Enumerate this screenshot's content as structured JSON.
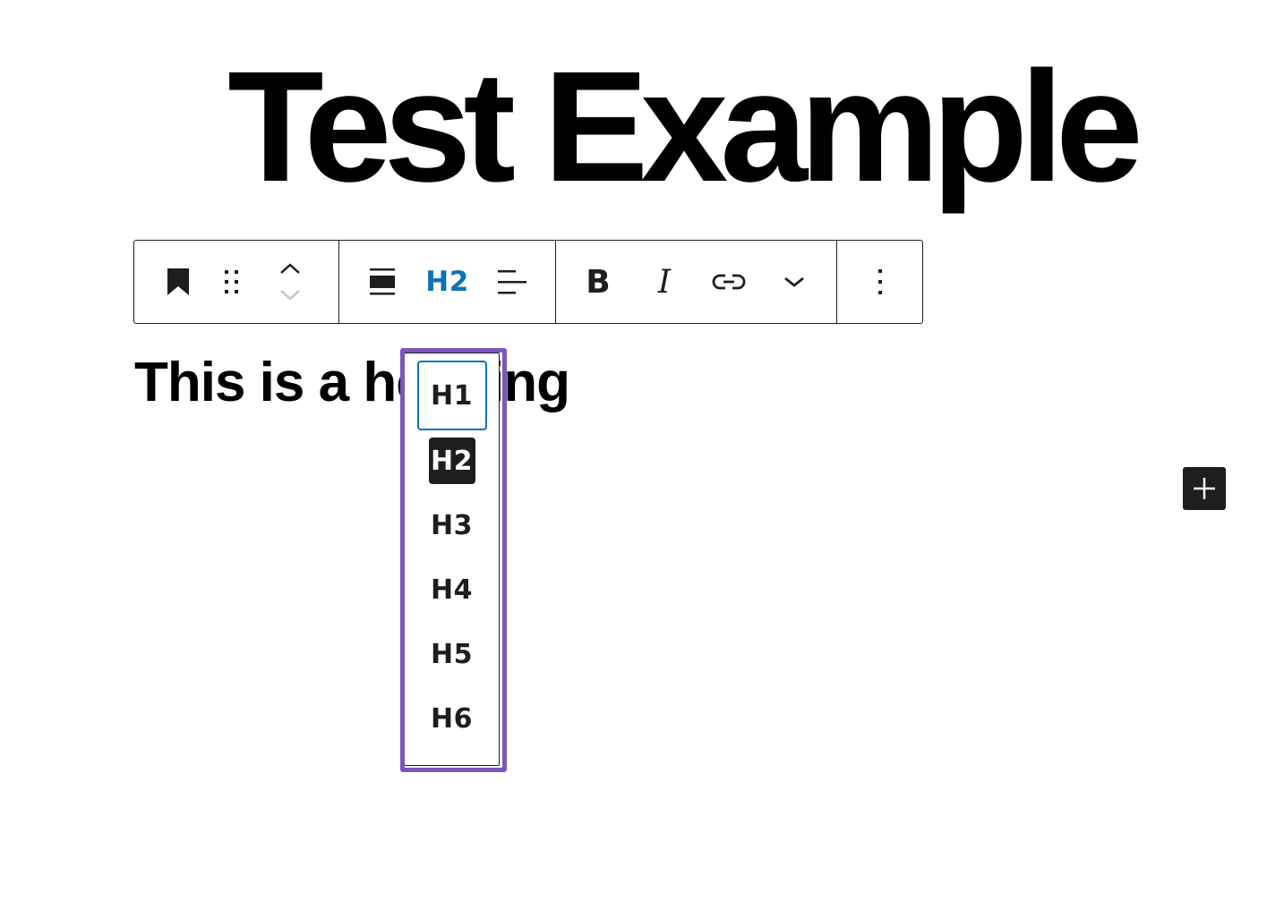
{
  "post": {
    "title": "Test Example"
  },
  "toolbar": {
    "block_icon": "bookmark-icon",
    "drag_handle": "drag-handle-icon",
    "move_up": "chevron-up-icon",
    "move_down": "chevron-down-icon",
    "align_icon": "align-wide-icon",
    "heading_level": "H2",
    "text_align_icon": "align-left-icon",
    "bold_label": "B",
    "italic_label": "I",
    "link_icon": "link-icon",
    "more_formats_icon": "chevron-down-icon",
    "options_icon": "more-vertical-icon",
    "accent_color": "#0b73b5"
  },
  "block": {
    "heading_text": "This is a heading"
  },
  "heading_level_menu": {
    "options": [
      "H1",
      "H2",
      "H3",
      "H4",
      "H5",
      "H6"
    ],
    "selected": "H2",
    "focused": "H1",
    "highlight_color": "#7b57b8"
  },
  "inserter": {
    "icon": "plus-icon"
  }
}
